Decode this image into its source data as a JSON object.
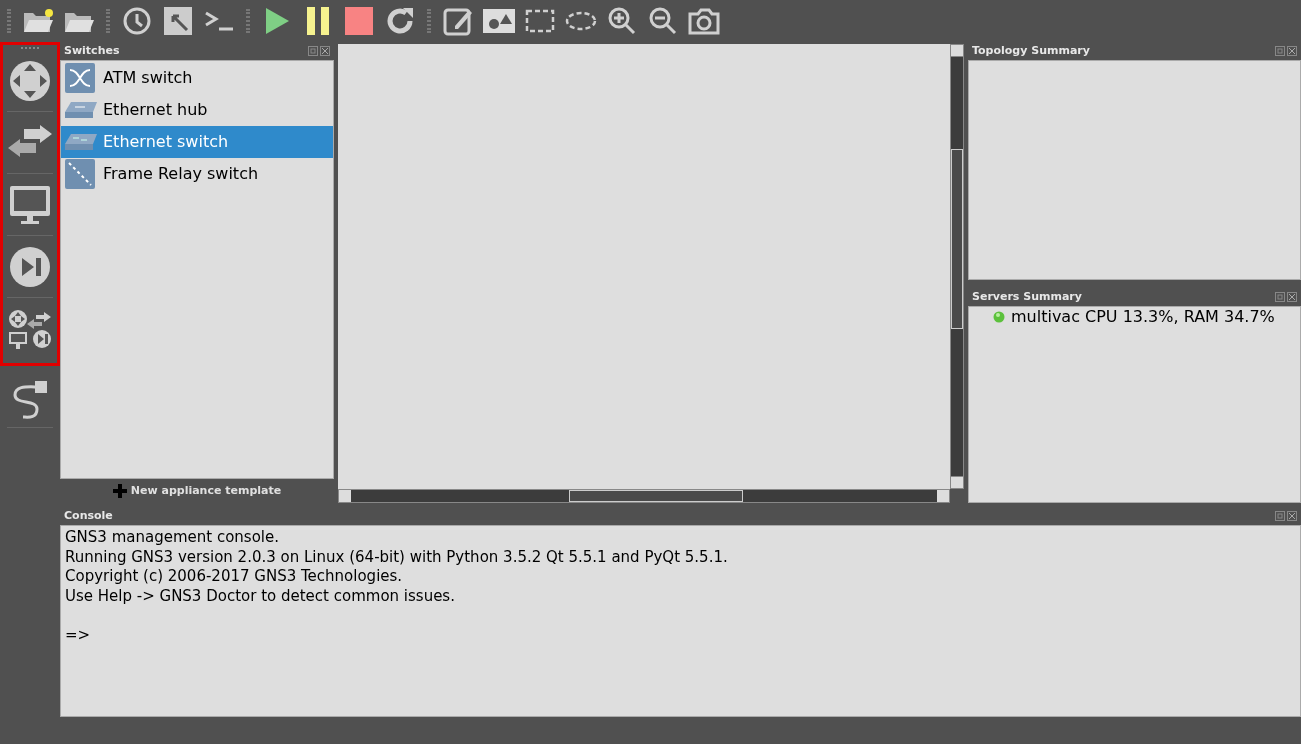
{
  "switches_panel": {
    "title": "Switches",
    "items": [
      {
        "label": "ATM switch",
        "kind": "atm",
        "selected": false
      },
      {
        "label": "Ethernet hub",
        "kind": "hub",
        "selected": false
      },
      {
        "label": "Ethernet switch",
        "kind": "switch",
        "selected": true
      },
      {
        "label": "Frame Relay switch",
        "kind": "frame",
        "selected": false
      }
    ],
    "new_template": "New appliance template"
  },
  "topology_summary": {
    "title": "Topology Summary"
  },
  "servers_summary": {
    "title": "Servers Summary",
    "servers": [
      {
        "text": "multivac CPU 13.3%, RAM 34.7%"
      }
    ]
  },
  "console": {
    "title": "Console",
    "lines": [
      "GNS3 management console.",
      "Running GNS3 version 2.0.3 on Linux (64-bit) with Python 3.5.2 Qt 5.5.1 and PyQt 5.5.1.",
      "Copyright (c) 2006-2017 GNS3 Technologies.",
      "Use Help -> GNS3 Doctor to detect common issues."
    ],
    "prompt": "=>"
  }
}
